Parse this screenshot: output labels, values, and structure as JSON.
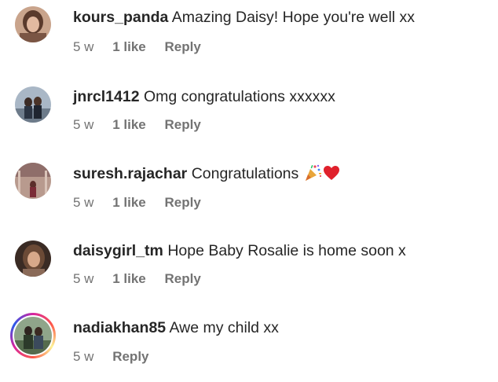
{
  "comments": [
    {
      "username": "kours_panda",
      "text": "Amazing Daisy! Hope you're well xx",
      "time": "5 w",
      "likes": "1 like",
      "reply": "Reply"
    },
    {
      "username": "jnrcl1412",
      "text": "Omg congratulations xxxxxx",
      "time": "5 w",
      "likes": "1 like",
      "reply": "Reply"
    },
    {
      "username": "suresh.rajachar",
      "text": "Congratulations",
      "emojis": [
        "party-popper-icon",
        "red-heart-icon"
      ],
      "time": "5 w",
      "likes": "1 like",
      "reply": "Reply"
    },
    {
      "username": "daisygirl_tm",
      "text": "Hope Baby Rosalie is home soon x",
      "time": "5 w",
      "likes": "1 like",
      "reply": "Reply"
    },
    {
      "username": "nadiakhan85",
      "text": "Awe my child xx",
      "time": "5 w",
      "reply": "Reply",
      "has_story_ring": true
    }
  ]
}
